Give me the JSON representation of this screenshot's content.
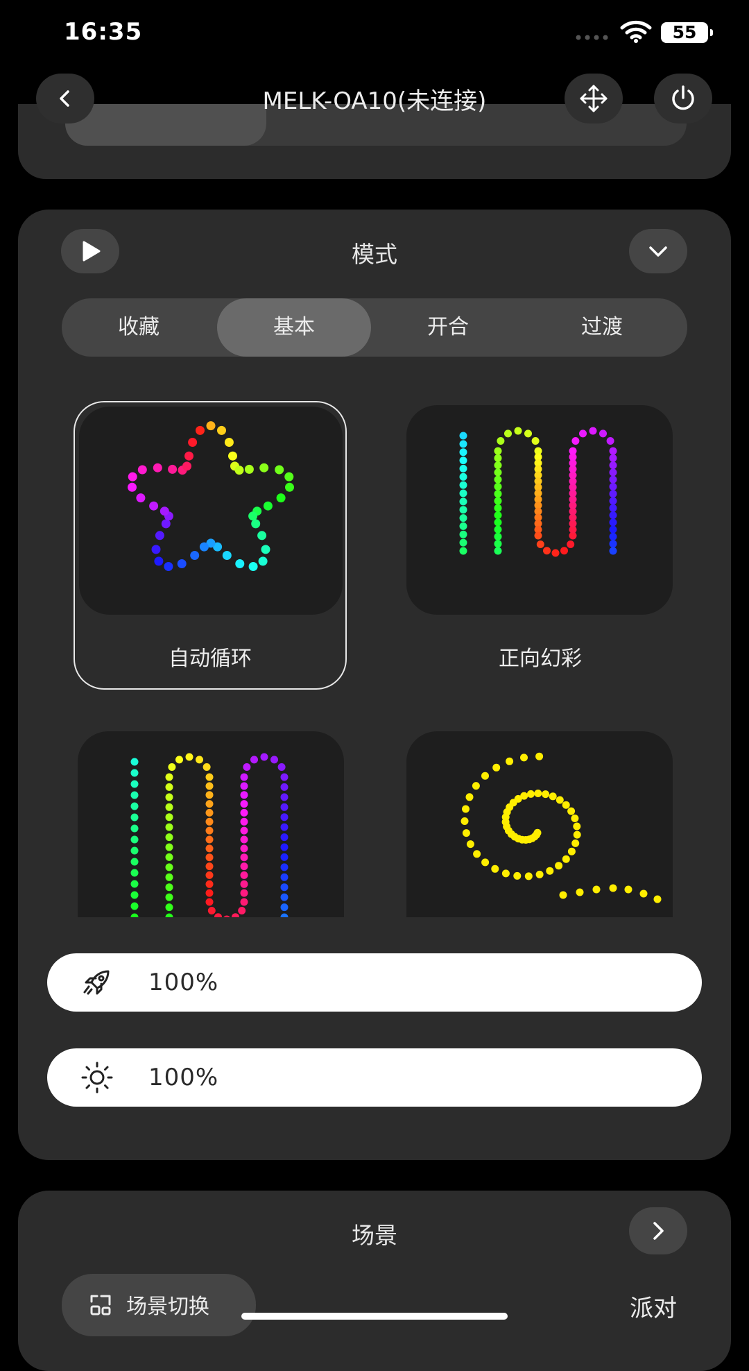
{
  "status_bar": {
    "time": "16:35",
    "battery": "55"
  },
  "header": {
    "title": "MELK-OA10(未连接)"
  },
  "mode_section": {
    "title": "模式",
    "tabs": [
      {
        "label": "收藏",
        "selected": false
      },
      {
        "label": "基本",
        "selected": true
      },
      {
        "label": "开合",
        "selected": false
      },
      {
        "label": "过渡",
        "selected": false
      }
    ],
    "modes": [
      {
        "label": "自动循环",
        "selected": true
      },
      {
        "label": "正向幻彩",
        "selected": false
      },
      {
        "label": "",
        "selected": false
      },
      {
        "label": "",
        "selected": false
      }
    ],
    "speed": {
      "value_text": "100%",
      "level": 1.0
    },
    "brightness": {
      "value_text": "100%",
      "level": 1.0
    }
  },
  "scene_section": {
    "title": "场景",
    "switch_label": "场景切换",
    "current_scene": "派对"
  },
  "icons": {
    "back": "chevron-left-icon",
    "move": "move-arrows-icon",
    "power": "power-icon",
    "play": "play-icon",
    "collapse": "chevron-down-icon",
    "speed": "rocket-icon",
    "brightness": "sun-icon",
    "scene_next": "chevron-right-icon",
    "scene_switch": "scene-switch-icon"
  },
  "colors": {
    "background": "#000000",
    "card": "#2c2c2c",
    "selected_tab": "#6a6a6a",
    "pill": "#ffffff"
  }
}
